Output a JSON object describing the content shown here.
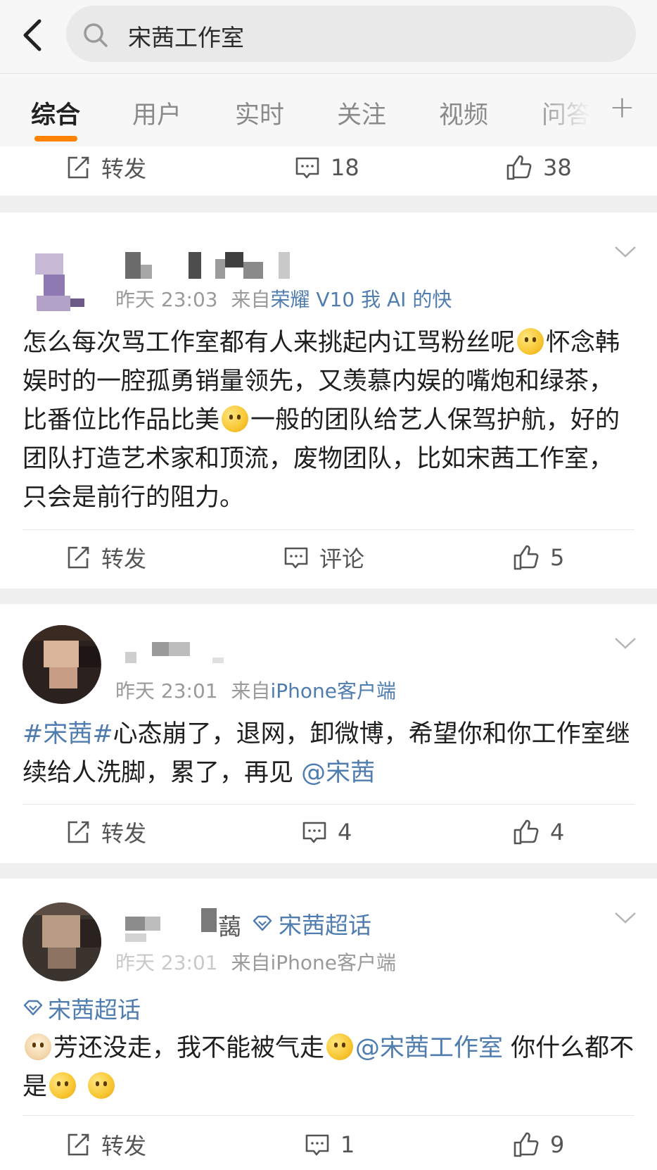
{
  "search": {
    "query": "宋茜工作室"
  },
  "tabs": [
    "综合",
    "用户",
    "实时",
    "关注",
    "视频",
    "问答"
  ],
  "colors": {
    "accent": "#ff8200",
    "link": "#507daf",
    "meta": "#9a9a9a"
  },
  "prev_post_actions": {
    "repost": "转发",
    "comments": "18",
    "likes": "38"
  },
  "posts": [
    {
      "time": "昨天 23:03",
      "source_prefix": "来自",
      "source": "荣耀 V10 我 AI 的快",
      "text_1": "怎么每次骂工作室都有人来挑起内讧骂粉丝呢",
      "text_2": "怀念韩娱时的一腔孤勇销量领先，又羡慕内娱的嘴炮和绿茶，比番位比作品比美",
      "text_3": "一般的团队给艺人保驾护航，好的团队打造艺术家和顶流，废物团队，比如宋茜工作室，只会是前行的阻力。",
      "actions": {
        "repost": "转发",
        "comments": "评论",
        "likes": "5"
      }
    },
    {
      "time": "昨天 23:01",
      "source_prefix": "来自",
      "source": "iPhone客户端",
      "hashtag": "#宋茜#",
      "text_1": "心态崩了，退网，卸微博，希望你和你工作室继续给人洗脚，累了，再见",
      "mention": "@宋茜",
      "actions": {
        "repost": "转发",
        "comments": "4",
        "likes": "4"
      }
    },
    {
      "name_fragment": "藹",
      "supertopic": "宋茜超话",
      "time": "昨天 23:01",
      "source_prefix": "来自",
      "source": "iPhone客户端",
      "topic_tag": "宋茜超话",
      "text_1": "芳还没走，我不能被气走",
      "mention": "@宋茜工作室",
      "text_2": "你什么都不是",
      "actions": {
        "repost": "转发",
        "comments": "1",
        "likes": "9"
      }
    }
  ]
}
